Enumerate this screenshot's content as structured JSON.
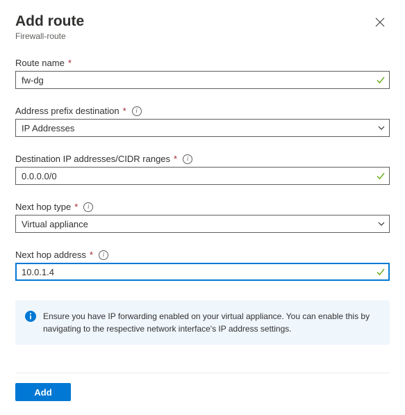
{
  "header": {
    "title": "Add route",
    "subtitle": "Firewall-route"
  },
  "fields": {
    "route_name": {
      "label": "Route name",
      "value": "fw-dg"
    },
    "address_prefix_destination": {
      "label": "Address prefix destination",
      "value": "IP Addresses"
    },
    "destination_cidr": {
      "label": "Destination IP addresses/CIDR ranges",
      "value": "0.0.0.0/0"
    },
    "next_hop_type": {
      "label": "Next hop type",
      "value": "Virtual appliance"
    },
    "next_hop_address": {
      "label": "Next hop address",
      "value": "10.0.1.4"
    }
  },
  "info_message": "Ensure you have IP forwarding enabled on your virtual appliance. You can enable this by navigating to the respective network interface's IP address settings.",
  "buttons": {
    "add": "Add"
  }
}
